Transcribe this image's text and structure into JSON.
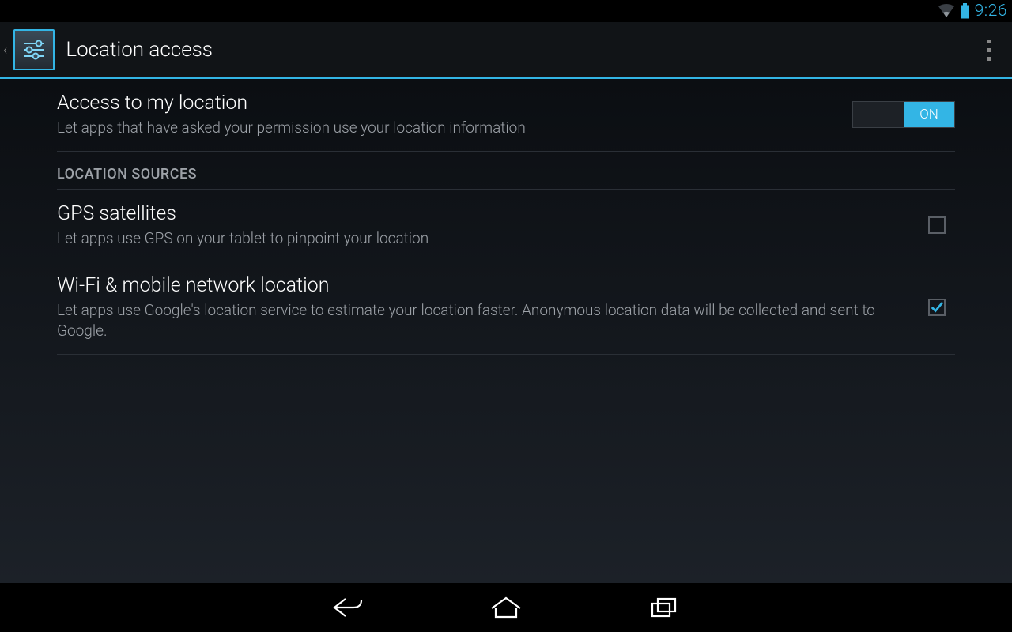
{
  "status": {
    "time": "9:26"
  },
  "actionbar": {
    "title": "Location access"
  },
  "settings": {
    "access": {
      "title": "Access to my location",
      "subtitle": "Let apps that have asked your permission use your location information",
      "toggle_on_label": "ON",
      "toggle_off_label": "",
      "value": true
    },
    "section_label": "LOCATION SOURCES",
    "gps": {
      "title": "GPS satellites",
      "subtitle": "Let apps use GPS on your tablet to pinpoint your location",
      "checked": false
    },
    "wifi": {
      "title": "Wi-Fi & mobile network location",
      "subtitle": "Let apps use Google's location service to estimate your location faster. Anonymous location data will be collected and sent to Google.",
      "checked": true
    }
  }
}
